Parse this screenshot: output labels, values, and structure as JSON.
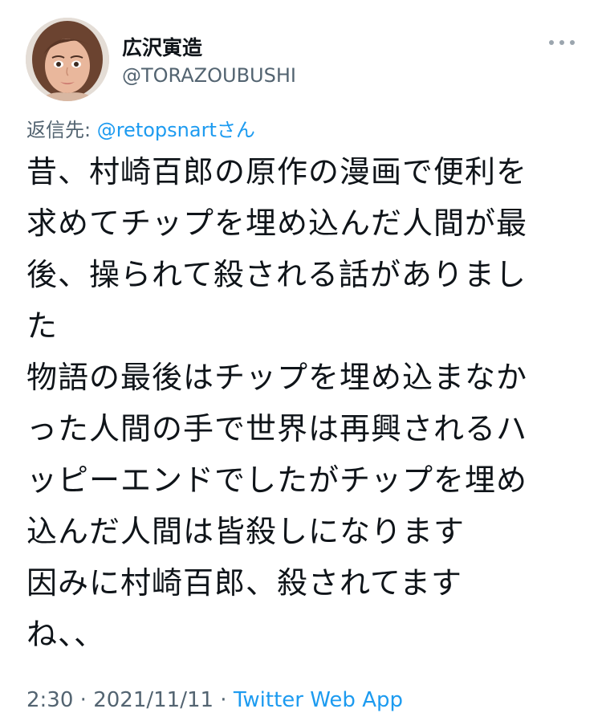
{
  "user": {
    "display_name": "広沢寅造",
    "handle": "@TORAZOUBUSHI"
  },
  "reply": {
    "prefix": "返信先: ",
    "mention": "@retopsnart",
    "suffix": "さん"
  },
  "tweet": {
    "lines": [
      "昔、村崎百郎の原作の漫画で便利を",
      "求めてチップを埋め込んだ人間が最",
      "後、操られて殺される話がありまし",
      "た",
      "物語の最後はチップを埋め込まなか",
      "った人間の手で世界は再興されるハ",
      "ッピーエンドでしたがチップを埋め",
      "込んだ人間は皆殺しになります",
      "因みに村崎百郎、殺されてます",
      "ね、、"
    ]
  },
  "meta": {
    "time": "2:30",
    "separator": " · ",
    "date": "2021/11/11",
    "source": "Twitter Web App"
  },
  "icons": {
    "more": "more-horizontal-icon",
    "avatar": "avatar"
  },
  "colors": {
    "link": "#1d9bf0",
    "secondary_text": "#536471",
    "primary_text": "#0f1419"
  }
}
